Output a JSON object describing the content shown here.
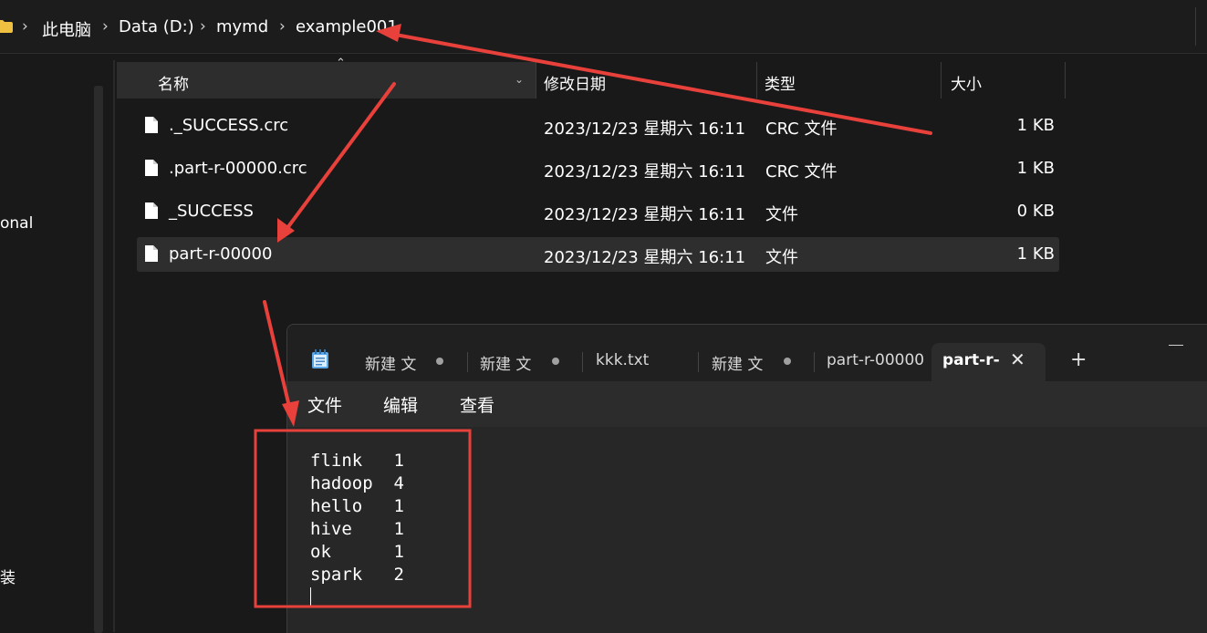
{
  "breadcrumb": [
    "此电脑",
    "Data (D:)",
    "mymd",
    "example001"
  ],
  "nav_fragments": {
    "item1": "onal",
    "item2": "装"
  },
  "columns": {
    "name": "名称",
    "date": "修改日期",
    "type": "类型",
    "size": "大小"
  },
  "files": [
    {
      "name": "._SUCCESS.crc",
      "date": "2023/12/23 星期六 16:11",
      "type": "CRC 文件",
      "size": "1 KB",
      "selected": false
    },
    {
      "name": ".part-r-00000.crc",
      "date": "2023/12/23 星期六 16:11",
      "type": "CRC 文件",
      "size": "1 KB",
      "selected": false
    },
    {
      "name": "_SUCCESS",
      "date": "2023/12/23 星期六 16:11",
      "type": "文件",
      "size": "0 KB",
      "selected": false
    },
    {
      "name": "part-r-00000",
      "date": "2023/12/23 星期六 16:11",
      "type": "文件",
      "size": "1 KB",
      "selected": true
    }
  ],
  "notepad": {
    "tabs": [
      {
        "label": "新建 文",
        "unsaved": true,
        "active": false
      },
      {
        "label": "新建 文",
        "unsaved": true,
        "active": false
      },
      {
        "label": "kkk.txt",
        "unsaved": false,
        "active": false
      },
      {
        "label": "新建 文",
        "unsaved": true,
        "active": false
      },
      {
        "label": "part-r-00000",
        "unsaved": false,
        "active": false
      },
      {
        "label": "part-r-",
        "unsaved": false,
        "active": true
      }
    ],
    "close_glyph": "✕",
    "new_tab_glyph": "+",
    "menu": {
      "file": "文件",
      "edit": "编辑",
      "view": "查看"
    },
    "lines": [
      "flink   1",
      "hadoop  4",
      "hello   1",
      "hive    1",
      "ok      1",
      "spark   2"
    ]
  },
  "colors": {
    "annotation": "#e8403a",
    "background": "#191919",
    "selected_row": "#2e2e2e"
  }
}
